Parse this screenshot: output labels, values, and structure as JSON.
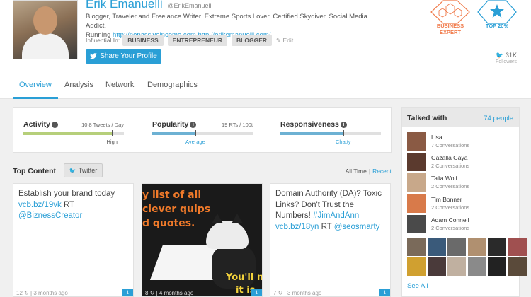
{
  "profile": {
    "name": "Erik Emanuelli",
    "handle": "@ErikEmanuelli",
    "bio_line1": "Blogger, Traveler and Freelance Writer. Extreme Sports Lover. Certified Skydiver. Social Media Addict.",
    "bio_running": "Running",
    "link1": "http://nopassiveincome.com",
    "link2": "http://erikemanuelli.com/",
    "influential_label": "Influential In:",
    "tags": [
      "BUSINESS",
      "ENTREPRENEUR",
      "BLOGGER"
    ],
    "edit_label": "Edit",
    "share_label": "Share Your Profile",
    "followers_count": "31K",
    "followers_label": "Followers"
  },
  "badges": [
    {
      "label": "BUSINESS EXPERT",
      "color": "#f07a4a"
    },
    {
      "label": "TOP 20%",
      "color": "#2a9fd6"
    }
  ],
  "tabs": [
    {
      "label": "Overview",
      "active": true
    },
    {
      "label": "Analysis",
      "active": false
    },
    {
      "label": "Network",
      "active": false
    },
    {
      "label": "Demographics",
      "active": false
    }
  ],
  "stats": [
    {
      "title": "Activity",
      "value": "10.8 Tweets / Day",
      "level": "High",
      "fill": 0.88,
      "color": "#b6cf7a",
      "label_color": "#555"
    },
    {
      "title": "Popularity",
      "value": "19 RTs / 100t",
      "level": "Average",
      "fill": 0.43,
      "color": "#6db1d3",
      "label_color": "#2a9fd6"
    },
    {
      "title": "Responsiveness",
      "value": "",
      "level": "Chatty",
      "fill": 0.63,
      "color": "#6db1d3",
      "label_color": "#2a9fd6"
    }
  ],
  "top_content": {
    "title": "Top Content",
    "twitter_button": "Twitter",
    "filter_all": "All Time",
    "filter_recent": "Recent"
  },
  "cards": [
    {
      "text": "Establish your brand today",
      "link1": "vcb.bz/19vk",
      "rt": "RT",
      "mention": "@BiznessCreator",
      "footer": "12 ↻ | 3 months ago"
    },
    {
      "img_line1": "y list of all",
      "img_line2": "clever quips",
      "img_line3": "d quotes.",
      "img_bottom1": "You'll no",
      "img_bottom2": "it is",
      "footer": "8 ↻ | 4 months ago"
    },
    {
      "text": "Domain Authority (DA)? Toxic Links? Don't Trust the Numbers!",
      "hashtag": "#JimAndAnn",
      "link1": "vcb.bz/18yn",
      "rt": "RT",
      "mention": "@seosmarty",
      "footer": "7 ↻ | 3 months ago"
    }
  ],
  "talked_with": {
    "title": "Talked with",
    "count": "74 people",
    "people": [
      {
        "name": "Lisa",
        "conv": "7 Conversations",
        "color": "#8a5a44"
      },
      {
        "name": "Gazalla Gaya",
        "conv": "2 Conversations",
        "color": "#5b3a2e"
      },
      {
        "name": "Talia Wolf",
        "conv": "2 Conversations",
        "color": "#c8a88a"
      },
      {
        "name": "Tim Bonner",
        "conv": "2 Conversations",
        "color": "#d87a4a"
      },
      {
        "name": "Adam Connell",
        "conv": "2 Conversations",
        "color": "#4a4a4a"
      }
    ],
    "thumb_colors": [
      "#7a6a5a",
      "#3a5a7a",
      "#6a6a6a",
      "#b09070",
      "#2a2a2a",
      "#a05050",
      "#d0a030",
      "#4a3a3a",
      "#c0b0a0",
      "#8a8a8a",
      "#222222",
      "#5a4a3a"
    ],
    "see_all": "See All"
  }
}
